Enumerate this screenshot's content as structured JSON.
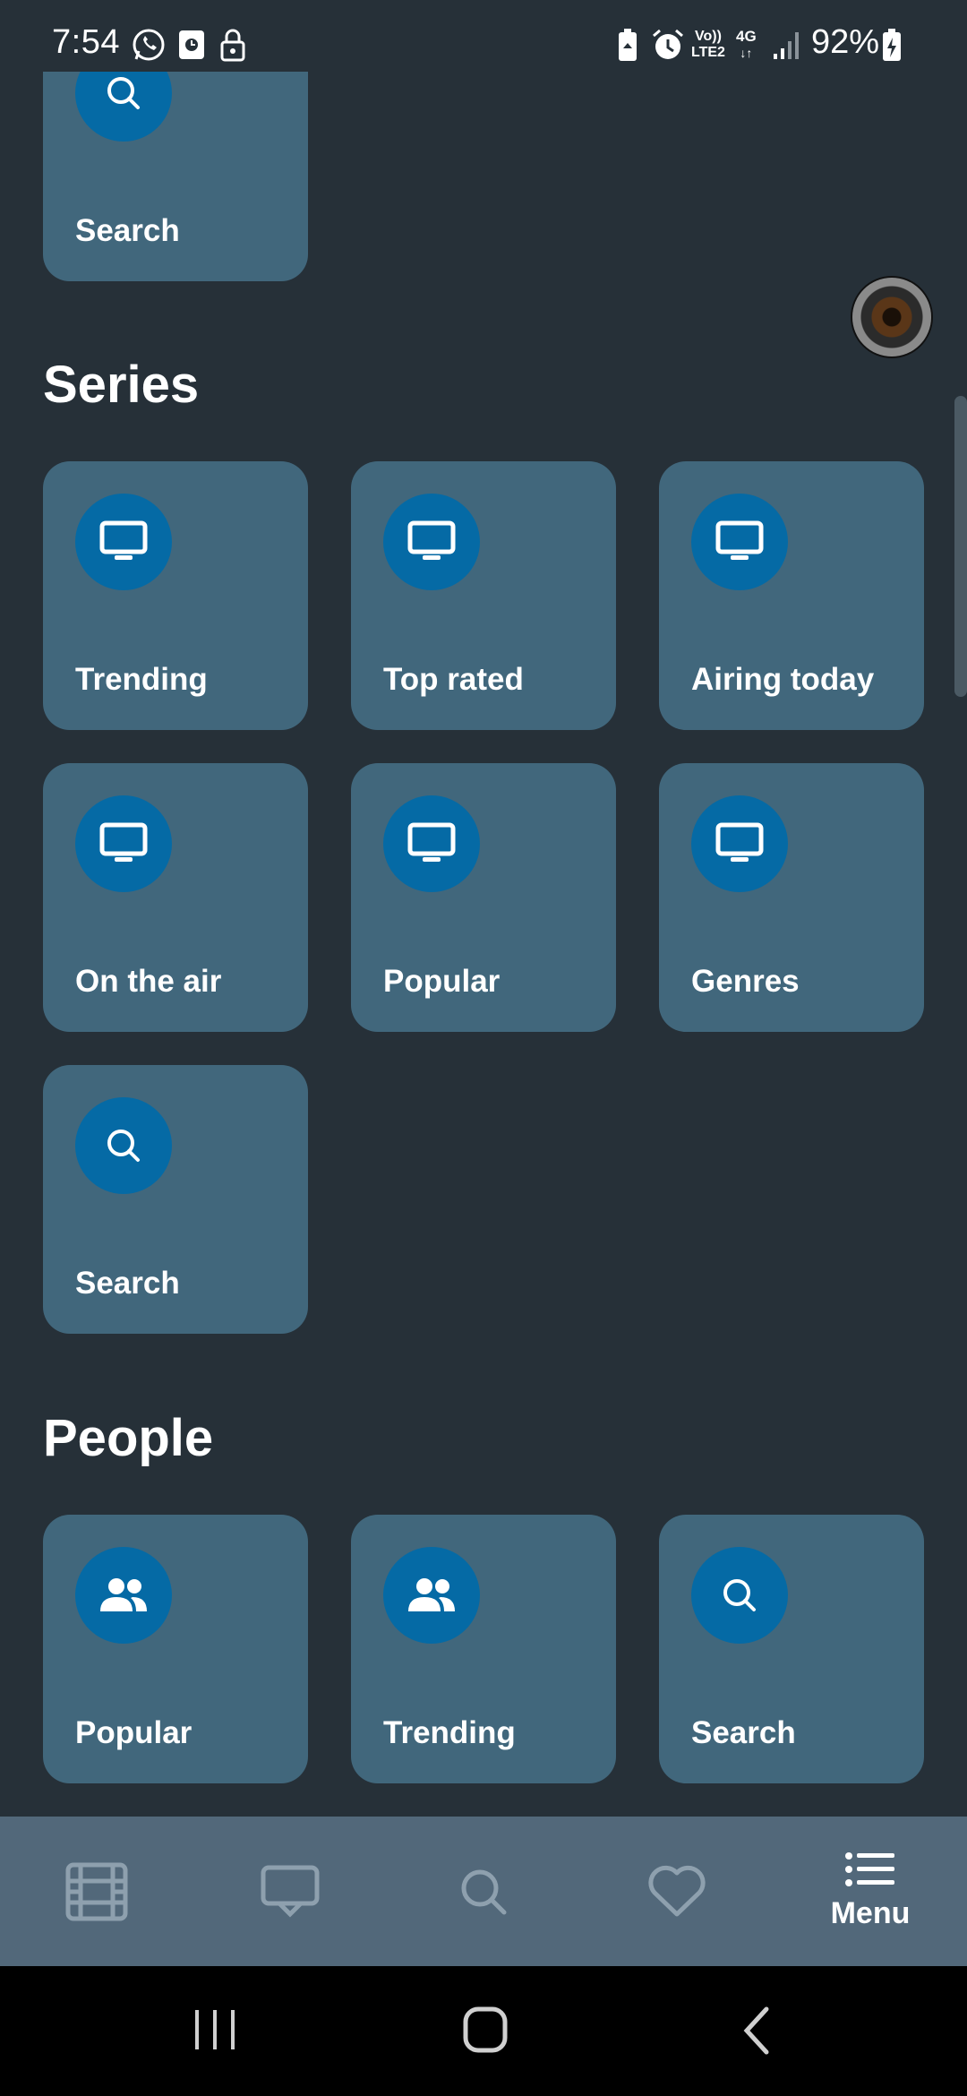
{
  "status_bar": {
    "time": "7:54",
    "battery": "92%",
    "left_icons": [
      "whatsapp-icon",
      "screenshot-icon",
      "lock-icon"
    ],
    "right_icons": [
      "battery-saver-icon",
      "alarm-icon",
      "volte-icon",
      "4g-icon",
      "signal-icon",
      "battery-charging-icon"
    ],
    "network_vo": "Vo))",
    "network_lte": "LTE2",
    "network_4g": "4G"
  },
  "movies_section": {
    "partial_card": {
      "label": "Search",
      "icon": "search-icon"
    }
  },
  "series": {
    "title": "Series",
    "cards": [
      {
        "label": "Trending",
        "icon": "tv-icon"
      },
      {
        "label": "Top rated",
        "icon": "tv-icon"
      },
      {
        "label": "Airing today",
        "icon": "tv-icon"
      },
      {
        "label": "On the air",
        "icon": "tv-icon"
      },
      {
        "label": "Popular",
        "icon": "tv-icon"
      },
      {
        "label": "Genres",
        "icon": "tv-icon"
      },
      {
        "label": "Search",
        "icon": "search-icon"
      }
    ]
  },
  "people": {
    "title": "People",
    "cards": [
      {
        "label": "Popular",
        "icon": "people-icon"
      },
      {
        "label": "Trending",
        "icon": "people-icon"
      },
      {
        "label": "Search",
        "icon": "search-icon"
      }
    ]
  },
  "bottom_nav": {
    "items": [
      {
        "icon": "film-icon"
      },
      {
        "icon": "tv-chat-icon"
      },
      {
        "icon": "search-icon"
      },
      {
        "icon": "heart-icon"
      },
      {
        "icon": "menu-icon",
        "label": "Menu"
      }
    ]
  },
  "system_nav": [
    "recents-icon",
    "home-icon",
    "back-icon"
  ],
  "colors": {
    "background": "#263038",
    "card": "#41677c",
    "icon_circle": "#056aa5",
    "bottom_nav": "#52687a"
  }
}
